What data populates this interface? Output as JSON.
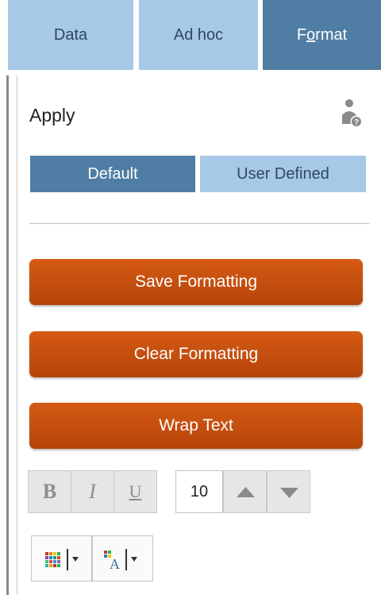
{
  "tabs": [
    {
      "label": "Data"
    },
    {
      "label": "Ad hoc"
    },
    {
      "label_pre": "F",
      "label_u": "o",
      "label_post": "rmat"
    }
  ],
  "apply": {
    "title": "Apply",
    "help_icon": "user-help-icon"
  },
  "segment": {
    "default_label": "Default",
    "user_label": "User Defined",
    "selected": "Default"
  },
  "buttons": {
    "save": "Save Formatting",
    "clear": "Clear Formatting",
    "wrap": "Wrap Text"
  },
  "format": {
    "bold": "B",
    "italic": "I",
    "underline": "U",
    "font_size": "10",
    "increase_icon": "triangle-up-icon",
    "decrease_icon": "triangle-down-icon"
  },
  "color_tools": {
    "fill_icon": "fill-color-grid-icon",
    "font_color_icon": "font-color-icon",
    "dropdown_icon": "chevron-down-icon"
  },
  "colors": {
    "tab_light": "#a7c8e6",
    "tab_active": "#4f7da3",
    "orange": "#c64f0e"
  }
}
